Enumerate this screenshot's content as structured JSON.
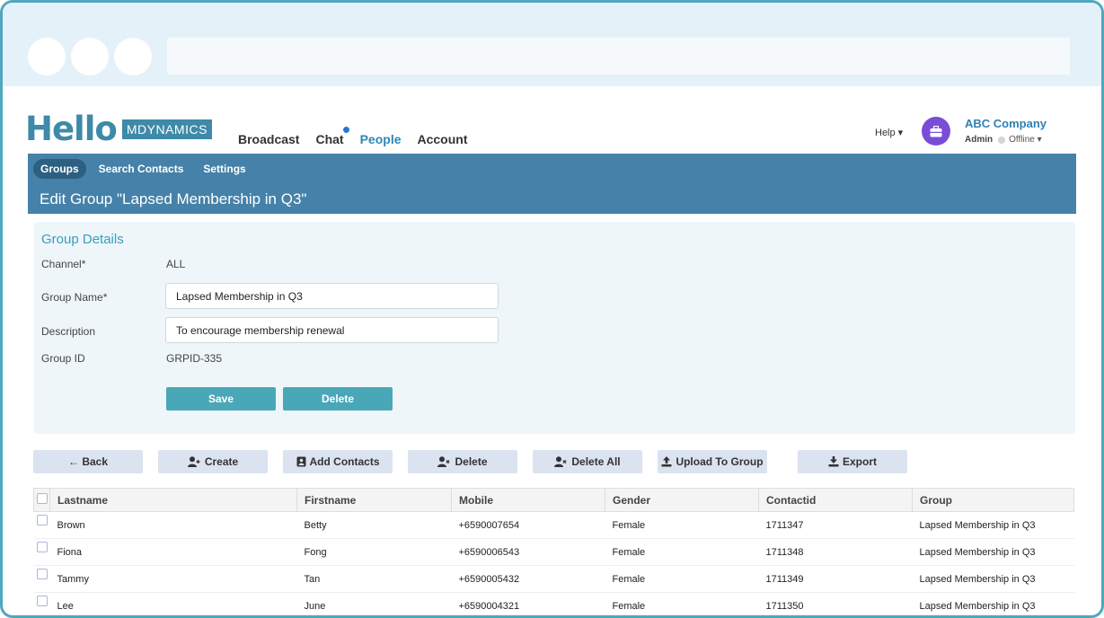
{
  "header": {
    "logo_word": "Hello",
    "logo_brand": "MDYNAMICS",
    "nav": [
      {
        "label": "Broadcast"
      },
      {
        "label": "Chat"
      },
      {
        "label": "People"
      },
      {
        "label": "Account"
      }
    ],
    "help_label": "Help ▾",
    "company": "ABC Company",
    "role": "Admin",
    "presence": "Offline ▾"
  },
  "subnav": [
    {
      "label": "Groups"
    },
    {
      "label": "Search Contacts"
    },
    {
      "label": "Settings"
    }
  ],
  "page_title": "Edit Group \"Lapsed Membership in Q3\"",
  "details": {
    "title": "Group Details",
    "channel_label": "Channel*",
    "channel_value": "ALL",
    "name_label": "Group Name*",
    "name_value": "Lapsed Membership in Q3",
    "desc_label": "Description",
    "desc_value": "To encourage membership renewal",
    "id_label": "Group ID",
    "id_value": "GRPID-335",
    "save_label": "Save",
    "delete_label": "Delete"
  },
  "toolbar": {
    "back": "← Back",
    "create": "Create",
    "add_contacts": "Add Contacts",
    "delete": "Delete",
    "delete_all": "Delete All",
    "upload": "Upload To Group",
    "export": "Export"
  },
  "table": {
    "headers": [
      "Lastname",
      "Firstname",
      "Mobile",
      "Gender",
      "Contactid",
      "Group"
    ],
    "rows": [
      [
        "Brown",
        "Betty",
        "+6590007654",
        "Female",
        "1711347",
        "Lapsed Membership in Q3"
      ],
      [
        "Fiona",
        "Fong",
        "+6590006543",
        "Female",
        "1711348",
        "Lapsed Membership in Q3"
      ],
      [
        "Tammy",
        "Tan",
        "+6590005432",
        "Female",
        "1711349",
        "Lapsed Membership in Q3"
      ],
      [
        "Lee",
        "June",
        "+6590004321",
        "Female",
        "1711350",
        "Lapsed Membership in Q3"
      ]
    ]
  },
  "colors": {
    "brand": "#3e8aa8",
    "banner": "#4581a8",
    "accent_teal": "#4aa7b8",
    "active_nav": "#2f86b6",
    "avatar": "#7a4dd6"
  }
}
